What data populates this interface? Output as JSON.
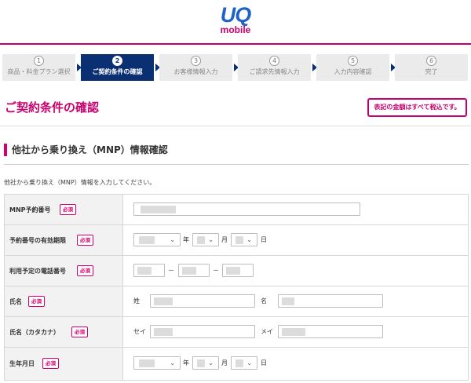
{
  "header": {
    "logo_uq": "UQ",
    "logo_mobile": "mobile"
  },
  "steps": [
    {
      "num": "1",
      "label": "商品・料金プラン選択",
      "active": false
    },
    {
      "num": "2",
      "label": "ご契約条件の確認",
      "active": true
    },
    {
      "num": "3",
      "label": "お客様情報入力",
      "active": false
    },
    {
      "num": "4",
      "label": "ご請求先情報入力",
      "active": false
    },
    {
      "num": "5",
      "label": "入力内容確認",
      "active": false
    },
    {
      "num": "6",
      "label": "完了",
      "active": false
    }
  ],
  "page": {
    "title": "ご契約条件の確認",
    "tax_note": "表記の金額はすべて税込です。"
  },
  "section": {
    "title": "他社から乗り換え（MNP）情報確認",
    "intro": "他社から乗り換え（MNP）情報を入力してください。"
  },
  "form": {
    "required_label": "必須",
    "rows": {
      "mnp": {
        "label": "MNP予約番号"
      },
      "expiry": {
        "label": "予約番号の有効期限",
        "year_unit": "年",
        "month_unit": "月",
        "day_unit": "日"
      },
      "phone": {
        "label": "利用予定の電話番号",
        "dash": "－"
      },
      "name": {
        "label": "氏名",
        "sei_label": "姓",
        "mei_label": "名"
      },
      "kana": {
        "label": "氏名（カタカナ）",
        "sei_label": "セイ",
        "mei_label": "メイ"
      },
      "birth": {
        "label": "生年月日",
        "year_unit": "年",
        "month_unit": "月",
        "day_unit": "日"
      }
    }
  },
  "icons": {
    "select_arrow": "chevron-down-icon"
  },
  "colors": {
    "brand_pink": "#c8006e",
    "brand_navy": "#0a2f73",
    "logo_blue": "#1e64c8"
  }
}
